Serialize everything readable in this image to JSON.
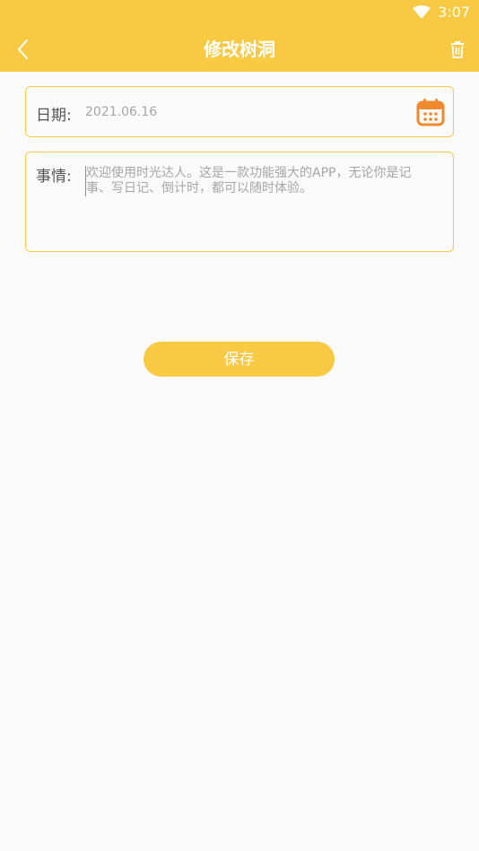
{
  "status_bar": {
    "time": "3:07",
    "wifi_icon": "wifi-icon"
  },
  "app_bar": {
    "title": "修改树洞",
    "back_icon": "chevron-left-icon",
    "delete_icon": "trash-icon",
    "color": "#f8ca44"
  },
  "form": {
    "date_label": "日期:",
    "date_value": "2021.06.16",
    "calendar_icon": "calendar-icon",
    "event_label": "事情:",
    "event_placeholder": "欢迎使用时光达人。这是一款功能强大的APP，无论你是记事、写日记、倒计时，都可以随时体验。"
  },
  "save_label": "保存"
}
